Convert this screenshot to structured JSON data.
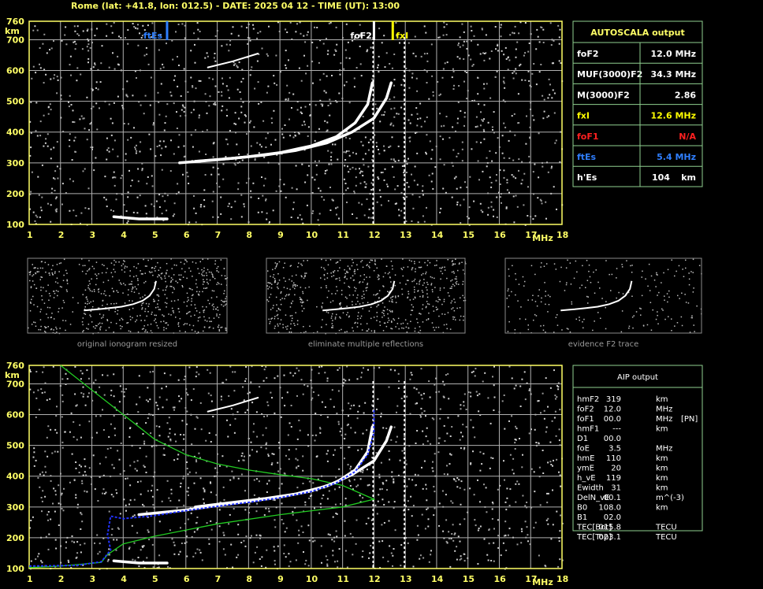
{
  "header": "Rome (lat: +41.8, lon: 012.5) - DATE: 2025 04 12 - TIME (UT): 13:00",
  "colors": {
    "axis": "#ffff66",
    "box": "#8fd08f",
    "grid": "#b0b0b0",
    "es": "#2f7fff",
    "fxi": "#ffff00",
    "fof1": "#ff2020",
    "profile": "#22cc22",
    "trace_fit": "#2233ff"
  },
  "chart_data": [
    {
      "type": "scatter",
      "name": "top-ionogram",
      "xlabel": "MHz",
      "ylabel": "km",
      "xlim": [
        1,
        18
      ],
      "ylim": [
        100,
        760
      ],
      "x_ticks": [
        "1",
        "2",
        "3",
        "4",
        "5",
        "6",
        "7",
        "8",
        "9",
        "10",
        "11",
        "12",
        "13",
        "14",
        "15",
        "16",
        "17",
        "18"
      ],
      "y_ticks": [
        "100",
        "200",
        "300",
        "400",
        "500",
        "600",
        "700",
        "760"
      ],
      "grid": true,
      "markers": [
        {
          "label": "ftEs",
          "x": 5.4
        },
        {
          "label": "foF2",
          "x": 12.0
        },
        {
          "label": "fxI",
          "x": 12.6
        }
      ],
      "traces": [
        {
          "name": "o-trace",
          "points": [
            [
              5.8,
              300
            ],
            [
              7,
              310
            ],
            [
              8,
              320
            ],
            [
              9,
              333
            ],
            [
              10,
              355
            ],
            [
              10.8,
              385
            ],
            [
              11.4,
              430
            ],
            [
              11.8,
              490
            ],
            [
              11.95,
              560
            ]
          ]
        },
        {
          "name": "x-trace",
          "points": [
            [
              6.3,
              305
            ],
            [
              7.5,
              315
            ],
            [
              8.5,
              325
            ],
            [
              9.5,
              340
            ],
            [
              10.5,
              365
            ],
            [
              11.3,
              400
            ],
            [
              12,
              445
            ],
            [
              12.4,
              510
            ],
            [
              12.55,
              560
            ]
          ]
        },
        {
          "name": "Es-trace",
          "points": [
            [
              3.7,
              125
            ],
            [
              4.5,
              118
            ],
            [
              5.4,
              118
            ]
          ]
        },
        {
          "name": "multiple-reflection",
          "points": [
            [
              6.7,
              610
            ],
            [
              7.5,
              630
            ],
            [
              8.3,
              655
            ]
          ]
        }
      ]
    },
    {
      "type": "scatter",
      "name": "bottom-ionogram",
      "xlabel": "MHz",
      "ylabel": "km",
      "xlim": [
        1,
        18
      ],
      "ylim": [
        100,
        760
      ],
      "x_ticks": [
        "1",
        "2",
        "3",
        "4",
        "5",
        "6",
        "7",
        "8",
        "9",
        "10",
        "11",
        "12",
        "13",
        "14",
        "15",
        "16",
        "17",
        "18"
      ],
      "y_ticks": [
        "100",
        "200",
        "300",
        "400",
        "500",
        "600",
        "700",
        "760"
      ],
      "grid": true,
      "traces": [
        {
          "name": "o-trace",
          "points": [
            [
              4.5,
              275
            ],
            [
              6,
              290
            ],
            [
              7,
              305
            ],
            [
              8,
              318
            ],
            [
              9,
              332
            ],
            [
              10,
              352
            ],
            [
              10.8,
              380
            ],
            [
              11.4,
              420
            ],
            [
              11.8,
              480
            ],
            [
              11.95,
              560
            ]
          ]
        },
        {
          "name": "x-trace",
          "points": [
            [
              6.3,
              300
            ],
            [
              7.5,
              315
            ],
            [
              8.5,
              327
            ],
            [
              9.5,
              342
            ],
            [
              10.5,
              368
            ],
            [
              11.3,
              405
            ],
            [
              12,
              450
            ],
            [
              12.4,
              515
            ],
            [
              12.55,
              560
            ]
          ]
        },
        {
          "name": "Es-trace",
          "points": [
            [
              3.7,
              125
            ],
            [
              4.5,
              118
            ],
            [
              5.4,
              118
            ]
          ]
        },
        {
          "name": "multiple-reflection",
          "points": [
            [
              6.7,
              610
            ],
            [
              7.5,
              630
            ],
            [
              8.3,
              655
            ]
          ]
        }
      ],
      "fit": {
        "name": "blue-fit",
        "points": [
          [
            1,
            108
          ],
          [
            2.5,
            110
          ],
          [
            3.3,
            122
          ],
          [
            3.6,
            160
          ],
          [
            3.5,
            210
          ],
          [
            3.6,
            270
          ],
          [
            4,
            262
          ],
          [
            5,
            272
          ],
          [
            6,
            288
          ],
          [
            7,
            302
          ],
          [
            8,
            315
          ],
          [
            9,
            330
          ],
          [
            10,
            350
          ],
          [
            10.8,
            378
          ],
          [
            11.4,
            415
          ],
          [
            11.8,
            470
          ],
          [
            12,
            540
          ],
          [
            12,
            620
          ]
        ]
      },
      "profile": {
        "name": "green-profile",
        "points": [
          [
            2,
            760
          ],
          [
            3,
            680
          ],
          [
            4,
            600
          ],
          [
            5,
            520
          ],
          [
            6,
            470
          ],
          [
            7,
            440
          ],
          [
            8,
            420
          ],
          [
            9,
            405
          ],
          [
            10,
            392
          ],
          [
            11,
            370
          ],
          [
            12,
            325
          ],
          [
            11,
            300
          ],
          [
            9,
            275
          ],
          [
            7,
            245
          ],
          [
            5,
            205
          ],
          [
            4,
            180
          ],
          [
            3.5,
            145
          ],
          [
            3.3,
            120
          ],
          [
            2,
            108
          ],
          [
            1,
            103
          ]
        ]
      }
    }
  ],
  "thumbnails": [
    {
      "caption": "original ionogram resized"
    },
    {
      "caption": "eliminate multiple reflections"
    },
    {
      "caption": "evidence F2 trace"
    }
  ],
  "autoscala": {
    "title": "AUTOSCALA output",
    "rows": [
      {
        "label": "foF2",
        "value": "12.0 MHz",
        "color": "#ffffff"
      },
      {
        "label": "MUF(3000)F2",
        "value": "34.3 MHz",
        "color": "#ffffff"
      },
      {
        "label": "M(3000)F2",
        "value": "2.86",
        "color": "#ffffff"
      },
      {
        "label": "fxI",
        "value": "12.6 MHz",
        "color": "#ffff00"
      },
      {
        "label": "foF1",
        "value": "N/A",
        "color": "#ff2020"
      },
      {
        "label": "ftEs",
        "value": "5.4 MHz",
        "color": "#2f7fff"
      },
      {
        "label": "h'Es",
        "value": "104",
        "unit": "km",
        "color": "#ffffff"
      }
    ]
  },
  "aip": {
    "title": "AIP output",
    "rows": [
      {
        "k": "hmF2",
        "v": "319",
        "u": "km",
        "x": ""
      },
      {
        "k": "foF2",
        "v": "12.0",
        "u": "MHz",
        "x": ""
      },
      {
        "k": "foF1",
        "v": "00.0",
        "u": "MHz",
        "x": "[PN]"
      },
      {
        "k": "hmF1",
        "v": "---",
        "u": "km",
        "x": ""
      },
      {
        "k": "D1",
        "v": "00.0",
        "u": "",
        "x": ""
      },
      {
        "k": "foE",
        "v": "3.5",
        "u": "MHz",
        "x": ""
      },
      {
        "k": "hmE",
        "v": "110",
        "u": "km",
        "x": ""
      },
      {
        "k": "ymE",
        "v": "20",
        "u": "km",
        "x": ""
      },
      {
        "k": "h_vE",
        "v": "119",
        "u": "km",
        "x": ""
      },
      {
        "k": "Ewidth",
        "v": "31",
        "u": "km",
        "x": ""
      },
      {
        "k": "DelN_vE",
        "v": "00.1",
        "u": "m^(-3)",
        "x": ""
      },
      {
        "k": "B0",
        "v": "108.0",
        "u": "km",
        "x": ""
      },
      {
        "k": "B1",
        "v": "02.0",
        "u": "",
        "x": ""
      },
      {
        "k": "TEC[Bot]",
        "v": "015.8",
        "u": "TECU",
        "x": ""
      },
      {
        "k": "TEC[Top]",
        "v": "023.1",
        "u": "TECU",
        "x": ""
      }
    ]
  }
}
